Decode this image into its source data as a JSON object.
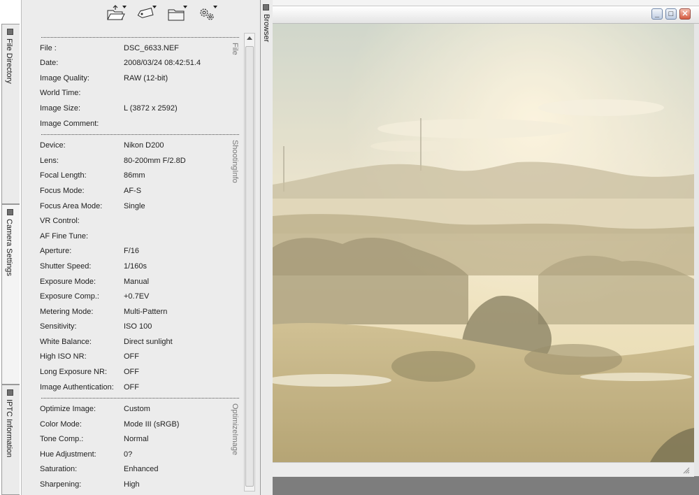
{
  "left_tabs": [
    {
      "label": "File Directory"
    },
    {
      "label": "Camera Settings"
    },
    {
      "label": "IPTC Information"
    }
  ],
  "toolbar": {
    "buttons": [
      {
        "icon": "open-folder-icon"
      },
      {
        "icon": "tag-label-icon"
      },
      {
        "icon": "folder-icon"
      },
      {
        "icon": "settings-gears-icon"
      }
    ]
  },
  "sections": {
    "file": "File",
    "shooting": "ShootingInfo",
    "optimize": "OptimizeImage"
  },
  "rows": [
    {
      "label": "File :",
      "value": "DSC_6633.NEF"
    },
    {
      "label": "Date:",
      "value": "2008/03/24 08:42:51.4"
    },
    {
      "label": "Image Quality:",
      "value": "RAW (12-bit)"
    },
    {
      "label": "World Time:",
      "value": ""
    },
    {
      "label": "Image Size:",
      "value": "L (3872 x 2592)"
    },
    {
      "label": "Image Comment:",
      "value": ""
    },
    {
      "label": "Device:",
      "value": "Nikon D200"
    },
    {
      "label": "Lens:",
      "value": "80-200mm F/2.8D"
    },
    {
      "label": "Focal Length:",
      "value": "86mm"
    },
    {
      "label": "Focus Mode:",
      "value": "AF-S"
    },
    {
      "label": "Focus Area Mode:",
      "value": "Single"
    },
    {
      "label": "VR Control:",
      "value": ""
    },
    {
      "label": "AF Fine Tune:",
      "value": ""
    },
    {
      "label": "Aperture:",
      "value": "F/16"
    },
    {
      "label": "Shutter Speed:",
      "value": "1/160s"
    },
    {
      "label": "Exposure Mode:",
      "value": "Manual"
    },
    {
      "label": "Exposure Comp.:",
      "value": "+0.7EV"
    },
    {
      "label": "Metering Mode:",
      "value": "Multi-Pattern"
    },
    {
      "label": "Sensitivity:",
      "value": "ISO 100"
    },
    {
      "label": "White Balance:",
      "value": "Direct sunlight"
    },
    {
      "label": "High ISO NR:",
      "value": "OFF"
    },
    {
      "label": "Long Exposure NR:",
      "value": "OFF"
    },
    {
      "label": "Image Authentication:",
      "value": "OFF"
    },
    {
      "label": "Optimize Image:",
      "value": "Custom"
    },
    {
      "label": "Color Mode:",
      "value": "Mode III (sRGB)"
    },
    {
      "label": "Tone Comp.:",
      "value": "Normal"
    },
    {
      "label": "Hue Adjustment:",
      "value": "0?"
    },
    {
      "label": "Saturation:",
      "value": "Enhanced"
    },
    {
      "label": "Sharpening:",
      "value": "High"
    }
  ],
  "browser_tab": {
    "label": "Browser"
  },
  "window_controls": {
    "minimize": "_",
    "maximize": "□",
    "close": "✕"
  },
  "colors": {
    "panel_bg": "#ececec",
    "close_button": "#d45a3f",
    "photo_haze": "#e8dcb8"
  }
}
